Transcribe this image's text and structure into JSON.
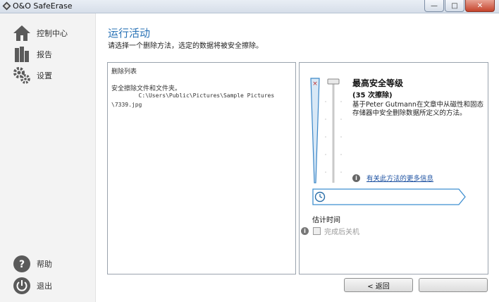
{
  "window": {
    "title": "O&O SafeErase",
    "minimize_glyph": "—",
    "maximize_glyph": "□",
    "close_glyph": "✕"
  },
  "sidebar": {
    "items": [
      {
        "label": "控制中心",
        "icon": "home-icon"
      },
      {
        "label": "报告",
        "icon": "reports-icon"
      },
      {
        "label": "设置",
        "icon": "settings-gear-icon"
      }
    ],
    "bottom_items": [
      {
        "label": "帮助",
        "icon": "help-icon",
        "glyph": "?"
      },
      {
        "label": "退出",
        "icon": "power-icon"
      }
    ]
  },
  "main": {
    "title": "运行活动",
    "description": "请选择一个删除方法，选定的数据将被安全擦除。"
  },
  "delete_list": {
    "header": "删除列表",
    "line1": "安全擦除文件和文件夹。",
    "path": "        C:\\Users\\Public\\Pictures\\Sample Pictures\n\\7339.jpg"
  },
  "security": {
    "level_title": "最高安全等级",
    "level_subtitle": "(35 次擦除)",
    "level_description": "基于Peter Gutmann在文章中从磁性和固态存储器中安全删除数据所定义的方法。",
    "more_info_link": "有关此方法的更多信息",
    "estimated_time_label": "估计时间",
    "shutdown_label": "完成后关机",
    "shutdown_checked": false,
    "slider_level": 1.0
  },
  "buttons": {
    "back": "< 返回"
  },
  "colors": {
    "accent": "#2a73b6",
    "link": "#1a4fa0",
    "timebar": "#3f8fd0"
  }
}
